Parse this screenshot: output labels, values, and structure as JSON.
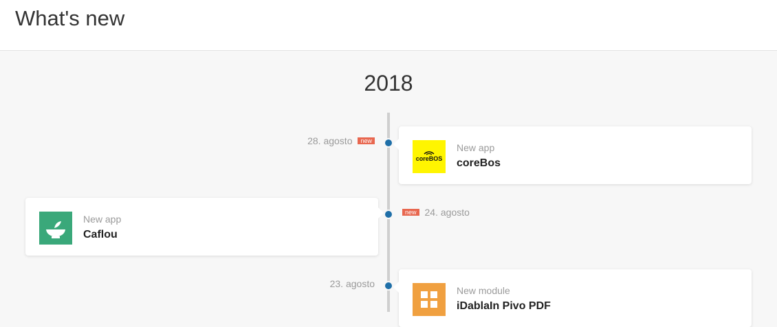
{
  "header": {
    "title": "What's new"
  },
  "timeline": {
    "year": "2018",
    "entries": [
      {
        "date": "28. agosto",
        "badge": "new",
        "type": "New app",
        "name": "coreBos"
      },
      {
        "date": "24. agosto",
        "badge": "new",
        "type": "New app",
        "name": "Caflou"
      },
      {
        "date": "23. agosto",
        "badge": "",
        "type": "New module",
        "name": "iDablaIn Pivo PDF"
      }
    ]
  },
  "logos": {
    "corebos": {
      "text": "coreBOS",
      "bg": "#fff500",
      "fg": "#111111"
    },
    "caflou": {
      "bg": "#3aa87a",
      "fg": "#ffffff"
    },
    "module": {
      "bg": "#f0a040",
      "fg": "#ffffff"
    }
  },
  "colors": {
    "accent_dot": "#1f6fa8",
    "badge": "#e8674f"
  }
}
